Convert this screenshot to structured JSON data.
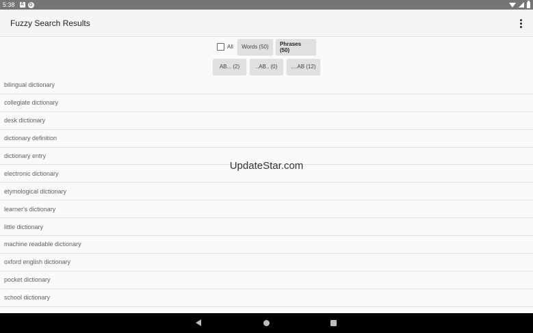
{
  "status_bar": {
    "time": "5:38",
    "icon_a_glyph": "A",
    "icon_b_glyph": "G"
  },
  "app_bar": {
    "title": "Fuzzy Search Results"
  },
  "filters": {
    "all_label": "All",
    "words_label": "Words (50)",
    "phrases_label": "Phrases (50)",
    "prefix_label": "AB... (2)",
    "infix_label": "..AB.. (0)",
    "suffix_label": "....AB (12)"
  },
  "results": [
    "bilingual dictionary",
    "collegiate dictionary",
    "desk dictionary",
    "dictionary definition",
    "dictionary entry",
    "electronic dictionary",
    "etymological dictionary",
    "learner's dictionary",
    "little dictionary",
    "machine readable dictionary",
    "oxford english dictionary",
    "pocket dictionary",
    "school dictionary"
  ],
  "watermark": "UpdateStar.com"
}
